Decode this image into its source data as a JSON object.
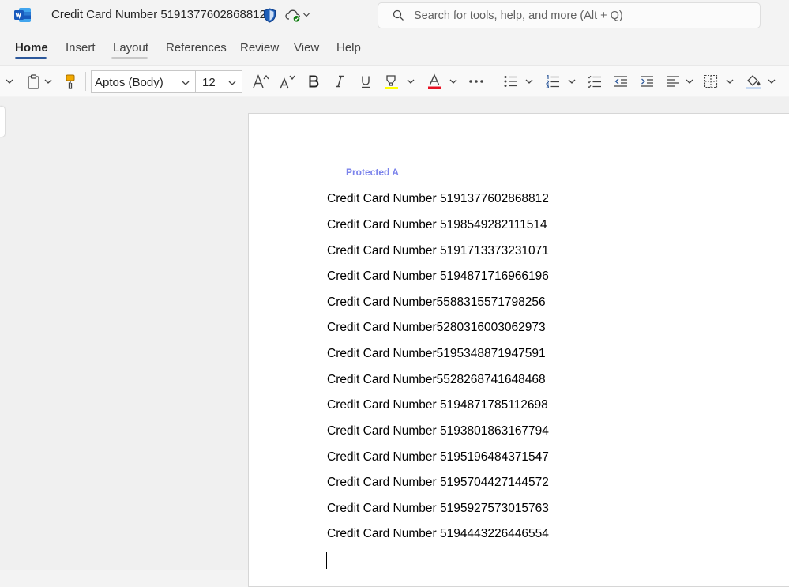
{
  "app": {
    "icon": "word-icon",
    "document_title": "Credit Card Number 5191377602868812",
    "sensitivity_icon": "shield-icon",
    "save_status_icon": "cloud-saved-icon",
    "search_placeholder": "Search for tools, help, and more (Alt + Q)"
  },
  "ribbon": {
    "tabs": [
      {
        "label": "Home",
        "active": true
      },
      {
        "label": "Insert"
      },
      {
        "label": "Layout"
      },
      {
        "label": "References"
      },
      {
        "label": "Review"
      },
      {
        "label": "View"
      },
      {
        "label": "Help"
      }
    ],
    "font_name": "Aptos (Body)",
    "font_size": "12"
  },
  "colors": {
    "accent": "#2b579a",
    "font_color_indicator": "#e81123",
    "highlight_indicator": "#ffff00",
    "sensitivity_label": "#7b83eb"
  },
  "document": {
    "sensitivity_label": "Protected A",
    "lines": [
      "Credit Card Number 5191377602868812",
      "Credit Card Number 5198549282111514",
      "Credit Card Number 5191713373231071",
      "Credit Card Number 5194871716966196",
      "Credit Card Number5588315571798256",
      "Credit Card Number5280316003062973",
      "Credit Card Number5195348871947591",
      "Credit Card Number5528268741648468",
      "Credit Card Number 5194871785112698",
      "Credit Card Number 5193801863167794",
      "Credit Card Number 5195196484371547",
      "Credit Card Number 5195704427144572",
      "Credit Card Number 5195927573015763",
      "Credit Card Number 5194443226446554"
    ]
  }
}
